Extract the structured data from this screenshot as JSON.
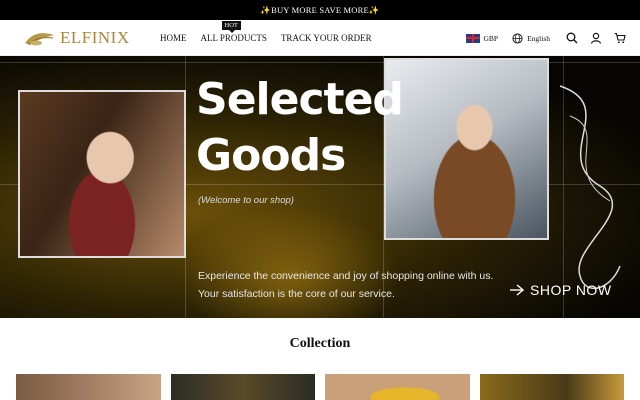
{
  "announcement": "✨BUY MORE SAVE MORE✨",
  "brand": {
    "name": "ELFINIX",
    "color": "#a8893a"
  },
  "nav": {
    "items": [
      {
        "label": "HOME"
      },
      {
        "label": "ALL PRODUCTS",
        "badge": "HOT"
      },
      {
        "label": "TRACK YOUR ORDER"
      }
    ]
  },
  "header_right": {
    "currency": "GBP",
    "language": "English",
    "icons": [
      "globe-icon",
      "search-icon",
      "account-icon",
      "cart-icon"
    ]
  },
  "hero": {
    "title_line1": "Selected",
    "title_line2": "Goods",
    "subtitle": "(Welcome to our shop)",
    "description": "Experience the convenience and joy of shopping online with us. Your satisfaction is the core of our service.",
    "cta": "SHOP NOW"
  },
  "collection": {
    "title": "Collection"
  }
}
